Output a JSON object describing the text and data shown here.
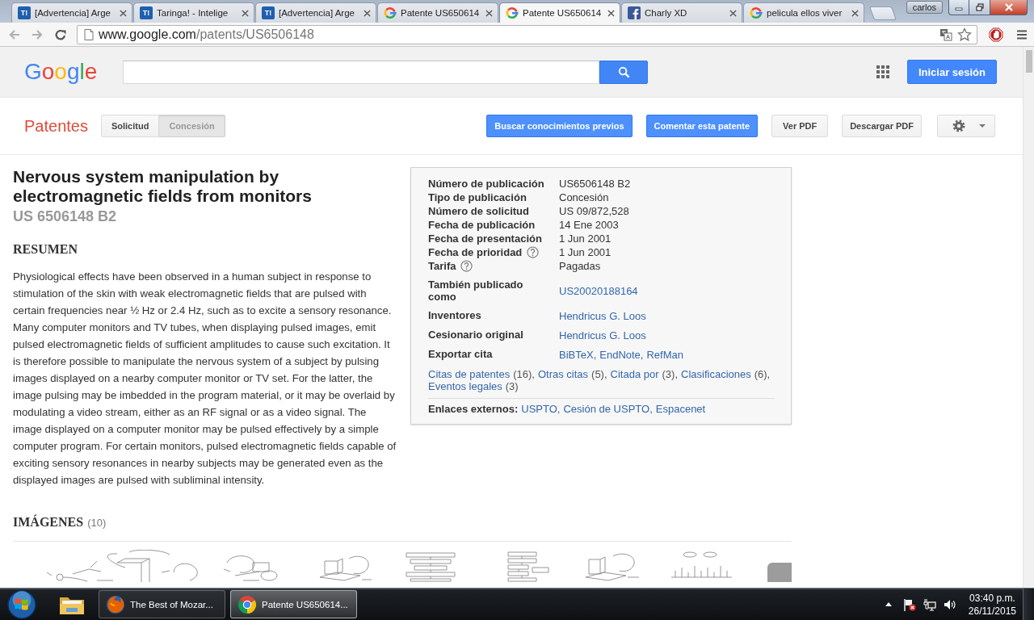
{
  "browser": {
    "tabs": [
      {
        "title": "[Advertencia] Arge",
        "favicon": {
          "kind": "taringa",
          "text": "T!"
        },
        "selected": false
      },
      {
        "title": "Taringa! - Intelige",
        "favicon": {
          "kind": "taringa",
          "text": "T!"
        },
        "selected": false
      },
      {
        "title": "[Advertencia] Arge",
        "favicon": {
          "kind": "taringa",
          "text": "T!"
        },
        "selected": false
      },
      {
        "title": "Patente US650614",
        "favicon": {
          "kind": "google"
        },
        "selected": false
      },
      {
        "title": "Patente US650614",
        "favicon": {
          "kind": "google"
        },
        "selected": true
      },
      {
        "title": "Charly XD",
        "favicon": {
          "kind": "facebook"
        },
        "selected": false
      },
      {
        "title": "pelicula ellos viver",
        "favicon": {
          "kind": "google"
        },
        "selected": false
      }
    ],
    "profile": "carlos",
    "address": {
      "host": "www.google.com",
      "path": "/patents/US6506148"
    }
  },
  "google_bar": {
    "logo": "Google",
    "signin_button": "Iniciar sesión"
  },
  "patent_bar": {
    "title": "Patentes",
    "view_toggle": [
      {
        "label": "Solicitud",
        "selected": false
      },
      {
        "label": "Concesión",
        "selected": true
      }
    ],
    "actions": [
      {
        "label": "Buscar conocimientos previos",
        "kind": "primary"
      },
      {
        "label": "Comentar esta patente",
        "kind": "primary"
      },
      {
        "label": "Ver PDF",
        "kind": "secondary"
      },
      {
        "label": "Descargar PDF",
        "kind": "secondary"
      }
    ]
  },
  "patent": {
    "title": "Nervous system manipulation by electromagnetic fields from monitors",
    "number": "US 6506148 B2",
    "abstract_heading": "RESUMEN",
    "abstract": "Physiological effects have been observed in a human subject in response to stimulation of the skin with weak electromagnetic fields that are pulsed with certain frequencies near ½ Hz or 2.4 Hz, such as to excite a sensory resonance. Many computer monitors and TV tubes, when displaying pulsed images, emit pulsed electromagnetic fields of sufficient amplitudes to cause such excitation. It is therefore possible to manipulate the nervous system of a subject by pulsing images displayed on a nearby computer monitor or TV set. For the latter, the image pulsing may be imbedded in the program material, or it may be overlaid by modulating a video stream, either as an RF signal or as a video signal. The image displayed on a computer monitor may be pulsed effectively by a simple computer program. For certain monitors, pulsed electromagnetic fields capable of exciting sensory resonances in nearby subjects may be generated even as the displayed images are pulsed with subliminal intensity.",
    "info": {
      "facts": [
        {
          "label": "Número de publicación",
          "value": "US6506148 B2",
          "help": false
        },
        {
          "label": "Tipo de publicación",
          "value": "Concesión",
          "help": false
        },
        {
          "label": "Número de solicitud",
          "value": "US 09/872,528",
          "help": false
        },
        {
          "label": "Fecha de publicación",
          "value": "14 Ene 2003",
          "help": false
        },
        {
          "label": "Fecha de presentación",
          "value": "1 Jun 2001",
          "help": false
        },
        {
          "label": "Fecha de prioridad",
          "value": "1 Jun 2001",
          "help": true
        },
        {
          "label": "Tarifa",
          "value": "Pagadas",
          "help": true
        }
      ],
      "related": [
        {
          "label": "También publicado como",
          "links": [
            "US20020188164"
          ]
        },
        {
          "label": "Inventores",
          "links": [
            "Hendricus G. Loos"
          ]
        },
        {
          "label": "Cesionario original",
          "links": [
            "Hendricus G. Loos"
          ]
        },
        {
          "label": "Exportar cita",
          "links": [
            "BiBTeX,",
            "EndNote,",
            "RefMan"
          ]
        }
      ],
      "sections": [
        {
          "label": "Citas de patentes",
          "count": "(16),"
        },
        {
          "label": "Otras citas",
          "count": "(5),"
        },
        {
          "label": "Citada por",
          "count": "(3),"
        },
        {
          "label": "Clasificaciones",
          "count": "(6),"
        },
        {
          "label": "Eventos legales",
          "count": "(3)"
        }
      ],
      "external": {
        "label": "Enlaces externos:",
        "links": [
          "USPTO,",
          "Cesión de USPTO,",
          "Espacenet"
        ]
      }
    },
    "images": {
      "heading": "IMÁGENES",
      "count": "(10)"
    }
  },
  "taskbar": {
    "tasks": [
      {
        "title": "The Best of Mozar...",
        "kind": "firefox",
        "selected": false
      },
      {
        "title": "Patente US650614...",
        "kind": "chrome",
        "selected": true
      }
    ],
    "clock": {
      "time": "03:40 p.m.",
      "date": "26/11/2015"
    }
  }
}
